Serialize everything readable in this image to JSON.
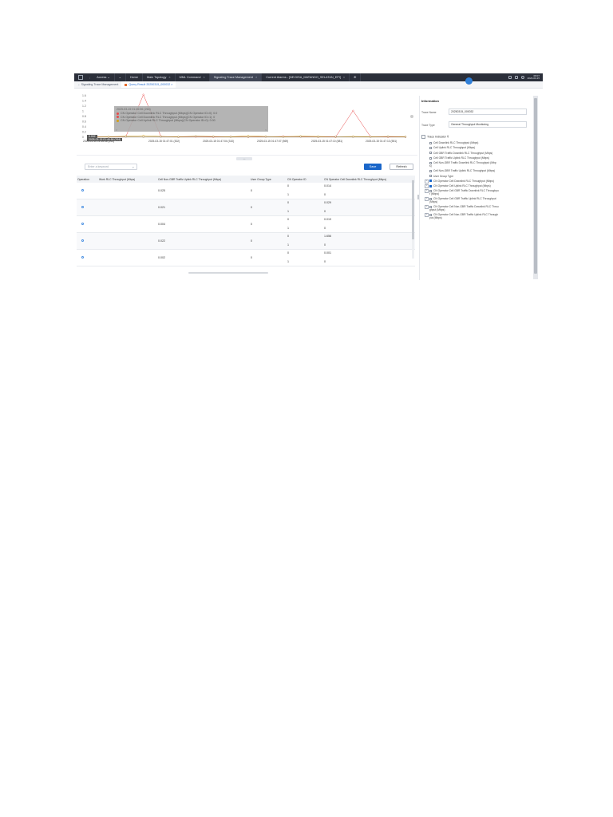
{
  "topbar": {
    "tabs": [
      {
        "label": "Access",
        "caret": true
      },
      {
        "label": "Home"
      },
      {
        "label": "Main Topology",
        "closable": true
      },
      {
        "label": "MML Command",
        "closable": true
      },
      {
        "label": "Signaling Trace Management",
        "closable": true,
        "active": true
      },
      {
        "label": "Current Alarms - [NE:DISA_MATANDO_SELATAN_EPI]",
        "closable": true
      }
    ],
    "close_glyph": "×",
    "clock_line1": "08:07",
    "clock_line2": "2023-03-15"
  },
  "subtabs": [
    {
      "label": "Signaling Trace Management",
      "active": false
    },
    {
      "label": "Query Result 20250315_000032",
      "active": true
    }
  ],
  "chart_data": {
    "type": "line",
    "y_ticks": [
      "1.6",
      "1.4",
      "1.2",
      "1",
      "0.8",
      "0.6",
      "0.4",
      "0.2",
      "0"
    ],
    "ylim": [
      0,
      1.6
    ],
    "x_tick_labels": [
      "2025-03-15 01:46:56 (264)",
      "2025-03-15 01:47:01 (302)",
      "2025-03-15 01:47:04 (310)",
      "2025-03-15 01:47:07 (569)",
      "2025-03-15 01:47:10 (581)",
      "2025-03-15 01:47:13 (551)"
    ],
    "series": [
      {
        "name": "CN Operator Cell Downlink RLC Throughput (Mbps)(CN Operator ID=0)",
        "color": "#e84a4a",
        "values": [
          0.02,
          0.01,
          0.03,
          1.64,
          0.03,
          0.01,
          0.02,
          0.01,
          0.02,
          0.01,
          0.02,
          0.03,
          0.02,
          0.01,
          0.01,
          1.02,
          0.02,
          0.01,
          0.01
        ]
      },
      {
        "name": "CN Operator Cell Downlink RLC Throughput (Mbps)(CN Operator ID=1)",
        "color": "#d4a017",
        "values": [
          0.01,
          0.02,
          0.04,
          0.06,
          0.03,
          0.02,
          0.04,
          0.03,
          0.02,
          0.05,
          0.03,
          0.02,
          0.04,
          0.03,
          0.02,
          0.03,
          0.02,
          0.03,
          0.02
        ]
      },
      {
        "name": "CN Operator Cell Uplink RLC Throughput (Mbps)(CN Operator ID=0)",
        "color": "#8a6d3b",
        "values": [
          0.0,
          0.01,
          0.02,
          0.01,
          0.02,
          0.01,
          0.03,
          0.02,
          0.01,
          0.01,
          0.02,
          0.01,
          0.02,
          0.01,
          0.02,
          0.01,
          0.01,
          0.02,
          0.01
        ]
      }
    ]
  },
  "tooltip": {
    "title": "2025-03-15 01:46:56 (264)",
    "rows": [
      {
        "text": "CN Operator Cell Downlink RLC Throughput (Mbps)(CN Operator ID=0): 0.0",
        "color": "#e84a4a"
      },
      {
        "text": "CN Operator Cell Downlink RLC Throughput (Mbps)(CN Operator ID=1): 0",
        "color": "#e84a4a"
      },
      {
        "text": "CN Operator Cell Uplink RLC Throughput (Mbps)(CN Operator ID=0): 0.00",
        "color": "#d4a017"
      }
    ],
    "left_arrow": "<",
    "right_arrow": ">"
  },
  "hover_label": "0.002",
  "hover_label2": "2025-03-15 01:46:56 (264)",
  "collapse_label": "‹ ›",
  "controls": {
    "search_placeholder": "Enter a keyword",
    "search_icon": "⌕",
    "save_label": "Save",
    "refresh_label": "Refresh"
  },
  "table": {
    "headers": [
      "Operation",
      "Work RLC Throughput (Mbps)",
      "Cell Non-GBR Traffic Uplink RLC Throughput (Mbps)",
      "User Group Type",
      "CN Operator ID",
      "CN Operator Cell Downlink RLC Throughput (Mbps)"
    ],
    "rows": [
      {
        "nongbr": "0.025",
        "ugt": "0",
        "ids": [
          "0",
          "1"
        ],
        "dl": [
          "0.014",
          "0"
        ]
      },
      {
        "nongbr": "0.021",
        "ugt": "0",
        "ids": [
          "0",
          "1"
        ],
        "dl": [
          "0.029",
          "0"
        ]
      },
      {
        "nongbr": "0.004",
        "ugt": "0",
        "ids": [
          "0",
          "1"
        ],
        "dl": [
          "0.019",
          "0"
        ]
      },
      {
        "nongbr": "0.022",
        "ugt": "0",
        "ids": [
          "0",
          "1"
        ],
        "dl": [
          "1.656",
          "0"
        ]
      },
      {
        "nongbr": "0.002",
        "ugt": "0",
        "ids": [
          "0",
          "1"
        ],
        "dl": [
          "0.001",
          "0"
        ]
      }
    ]
  },
  "info": {
    "title": "Information",
    "trace_name_label": "Trace Name",
    "trace_name_value": "20250315_000032",
    "trace_type_label": "Trace Type",
    "trace_type_value": "General Throughput Monitoring",
    "indicator_label": "Trace Indicator",
    "items": [
      {
        "label": "Cell Downlink RLC Throughput (Mbps)",
        "checked": false,
        "expandable": false
      },
      {
        "label": "Cell Uplink RLC Throughput (Mbps)",
        "checked": false,
        "expandable": false
      },
      {
        "label": "Cell GBR Traffic Downlink RLC Throughput (Mbps)",
        "checked": false,
        "expandable": false
      },
      {
        "label": "Cell GBR Traffic Uplink RLC Throughput (Mbps)",
        "checked": false,
        "expandable": false
      },
      {
        "label": "Cell Non-GBR Traffic Downlink RLC Throughput (Mbp",
        "label2": "s)",
        "checked": false,
        "expandable": false
      },
      {
        "label": "Cell Non-GBR Traffic Uplink RLC Throughput (Mbps)",
        "checked": false,
        "expandable": false
      },
      {
        "label": "User Group Type",
        "checked": false,
        "expandable": false
      },
      {
        "label": "CN Operator Cell Downlink RLC Throughput (Mbps)",
        "checked": true,
        "expandable": true
      },
      {
        "label": "CN Operator Cell Uplink RLC Throughput (Mbps)",
        "checked": true,
        "expandable": true
      },
      {
        "label": "CN Operator Cell GBR Traffic Downlink RLC Throughpu",
        "label2": "t (Mbps)",
        "checked": false,
        "expandable": true
      },
      {
        "label": "CN Operator Cell GBR Traffic Uplink RLC Throughput",
        "label2": "(Mbps)",
        "checked": false,
        "expandable": true
      },
      {
        "label": "CN Operator Cell Non-GBR Traffic Downlink RLC Throu",
        "label2": "ghput (Mbps)",
        "checked": false,
        "expandable": true
      },
      {
        "label": "CN Operator Cell Non-GBR Traffic Uplink RLC Through",
        "label2": "put (Mbps)",
        "checked": false,
        "expandable": true
      }
    ]
  }
}
